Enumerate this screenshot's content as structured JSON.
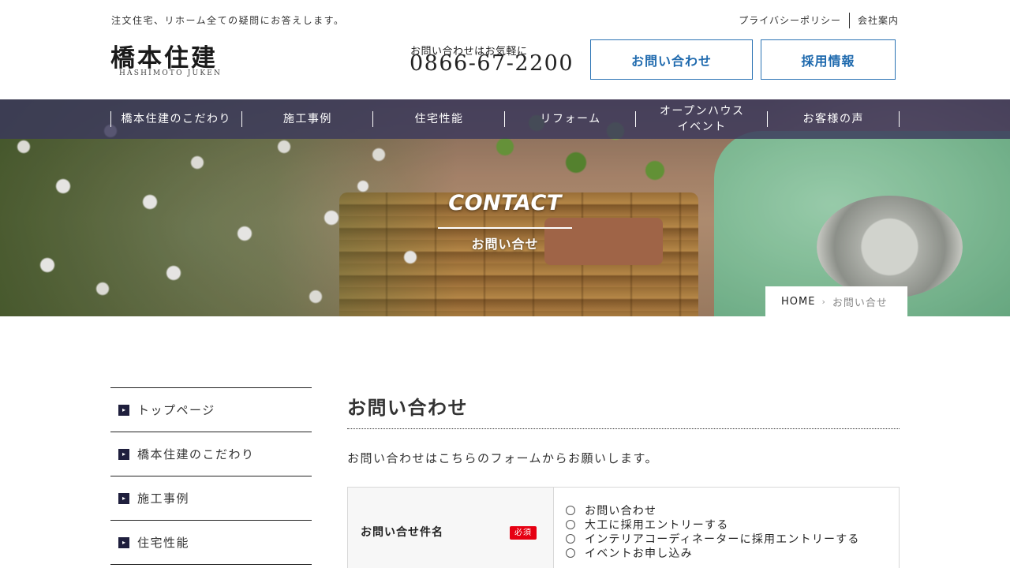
{
  "header": {
    "tagline": "注文住宅、リホーム全ての疑問にお答えします。",
    "logo_main": "橋本住建",
    "logo_sub": "HASHIMOTO JUKEN",
    "top_links": [
      "プライバシーポリシー",
      "会社案内"
    ],
    "phone_caption": "お問い合わせはお気軽に",
    "phone_number": "0866-67-2200",
    "contact_button": "お問い合わせ",
    "recruit_button": "採用情報",
    "accent_color": "#2b73b4"
  },
  "nav": {
    "items": [
      {
        "label": "橋本住建のこだわり"
      },
      {
        "label": "施工事例"
      },
      {
        "label": "住宅性能"
      },
      {
        "label": "リフォーム"
      },
      {
        "label_line1": "オープンハウス",
        "label_line2": "イベント"
      },
      {
        "label": "お客様の声"
      }
    ],
    "background": "#3a385c"
  },
  "hero": {
    "title": "CONTACT",
    "subtitle": "お問い合せ"
  },
  "breadcrumb": {
    "home": "HOME",
    "separator": "›",
    "current": "お問い合せ"
  },
  "sidebar": {
    "items": [
      {
        "label": "トップページ"
      },
      {
        "label": "橋本住建のこだわり"
      },
      {
        "label": "施工事例"
      },
      {
        "label": "住宅性能"
      }
    ]
  },
  "main": {
    "heading": "お問い合わせ",
    "intro": "お問い合わせはこちらのフォームからお願いします。",
    "form": {
      "field_label": "お問い合せ件名",
      "required_badge": "必須",
      "options": [
        "お問い合わせ",
        "大工に採用エントリーする",
        "インテリアコーディネーターに採用エントリーする",
        "イベントお申し込み"
      ]
    }
  }
}
